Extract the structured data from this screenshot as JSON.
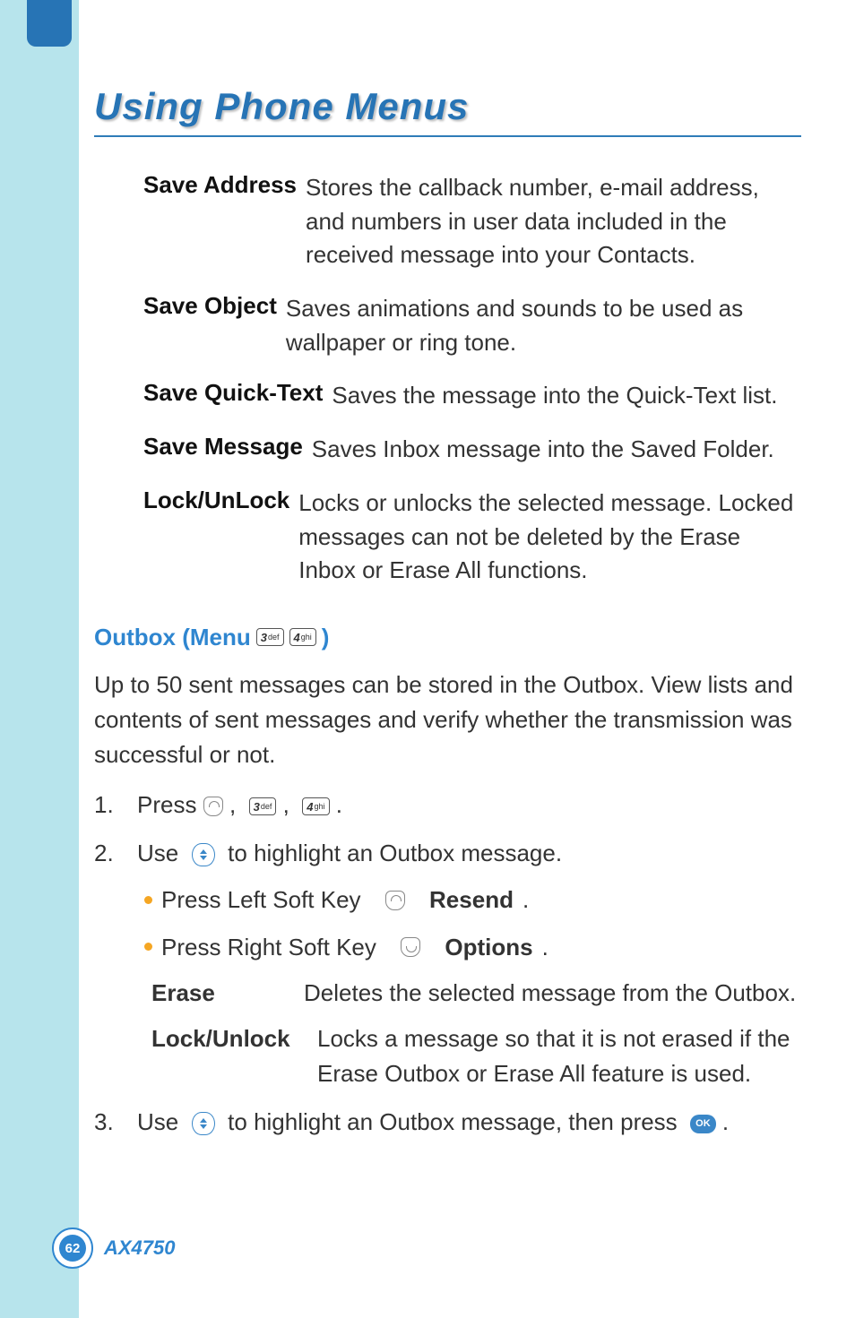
{
  "title": "Using Phone Menus",
  "defs": {
    "saveAddress": {
      "term": "Save Address",
      "desc": "Stores the callback number, e-mail address, and numbers in user data included in the received message into your Contacts."
    },
    "saveObject": {
      "term": "Save Object",
      "desc": "Saves animations and sounds to be used as wallpaper or ring tone."
    },
    "saveQuickText": {
      "term": "Save Quick-Text",
      "desc": "Saves the message into the Quick-Text list."
    },
    "saveMessage": {
      "term": "Save Message",
      "desc": "Saves Inbox message into the Saved Folder."
    },
    "lockUnlock": {
      "term": "Lock/UnLock",
      "desc": "Locks or unlocks the selected message. Locked messages can not be deleted by the Erase Inbox or Erase All functions."
    }
  },
  "section": {
    "label_pre": "Outbox (Menu",
    "label_post": ")",
    "key1": "3",
    "key1_sub": "def",
    "key2": "4",
    "key2_sub": "ghi"
  },
  "intro": "Up to 50 sent messages can be stored in the Outbox. View lists and contents of sent messages and verify whether the transmission was successful or not.",
  "steps": {
    "s1_pre": "Press",
    "s1_mid1": ",",
    "s1_mid2": ",",
    "s1_end": ".",
    "s2_pre": "Use",
    "s2_post": "to highlight an Outbox message.",
    "b1_pre": "Press Left Soft Key",
    "b1_bold": "Resend",
    "b2_pre": "Press Right Soft Key",
    "b2_bold": "Options",
    "erase_term": "Erase",
    "erase_desc": "Deletes the selected message from the Outbox.",
    "lock_term": "Lock/Unlock",
    "lock_desc": "Locks a message so that it is not erased if the Erase Outbox or Erase All feature is used.",
    "s3_pre": "Use",
    "s3_mid": "to highlight an Outbox message, then press",
    "s3_end": "."
  },
  "footer": {
    "page": "62",
    "model": "AX4750"
  },
  "icons": {
    "ok": "OK"
  }
}
